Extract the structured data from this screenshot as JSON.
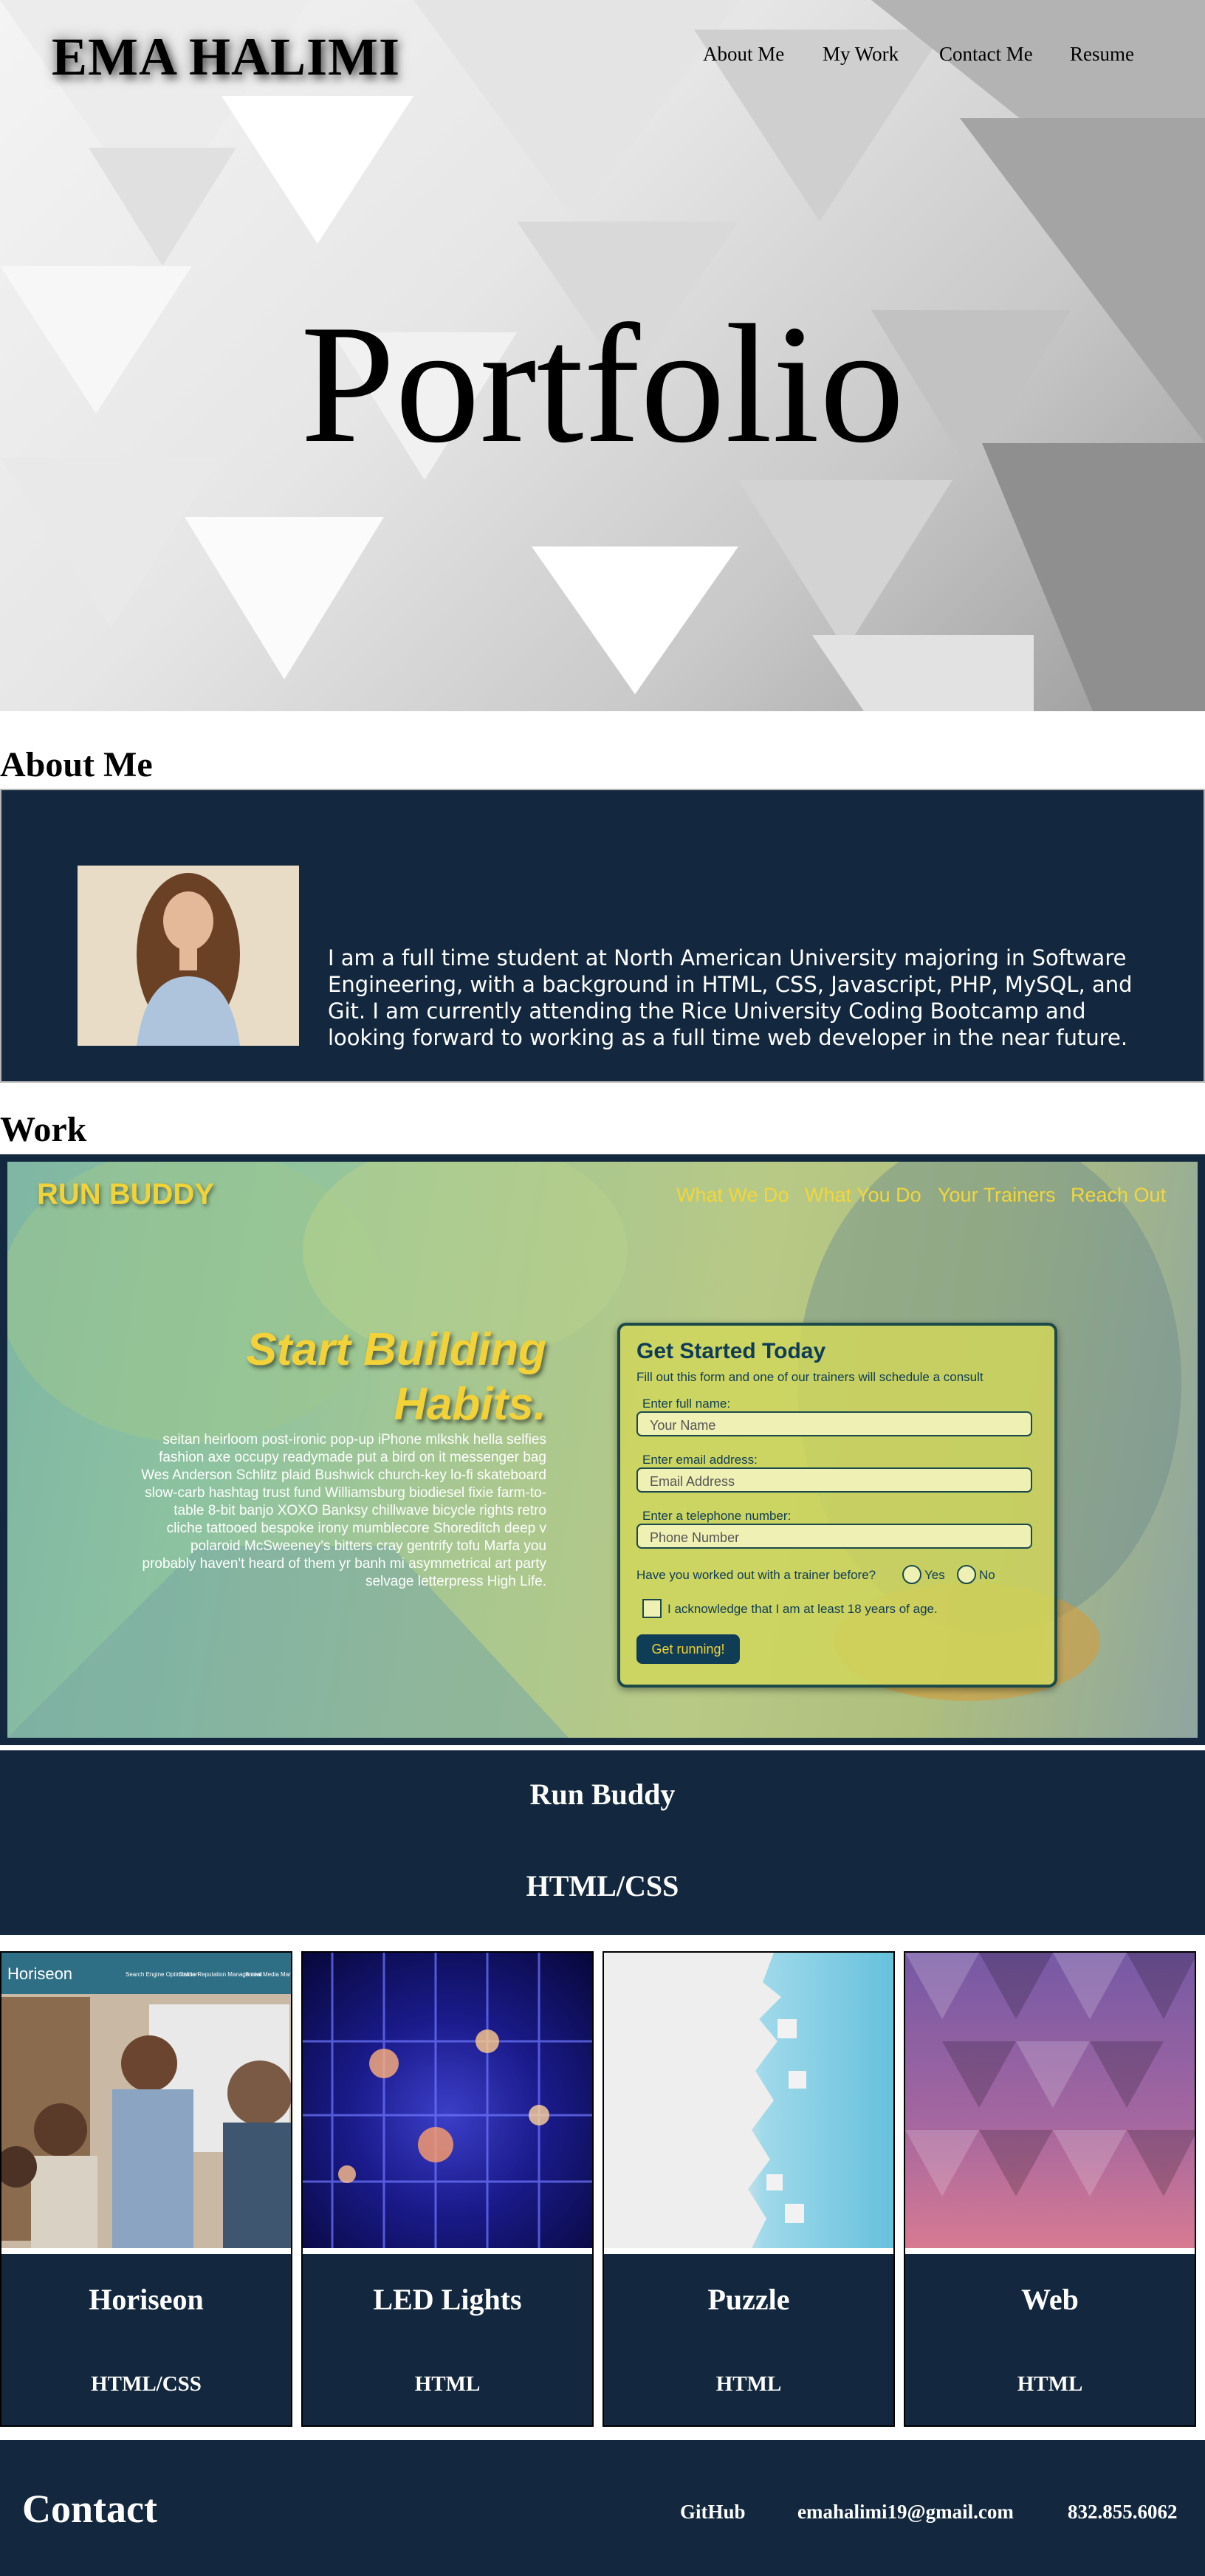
{
  "header": {
    "logo": "EMA HALIMI",
    "nav": [
      "About Me",
      "My Work",
      "Contact Me",
      "Resume"
    ]
  },
  "hero": {
    "title": "Portfolio"
  },
  "about": {
    "heading": "About Me",
    "bio": "I am a full time student at North American University majoring in Software Engineering, with a background in HTML, CSS, Javascript, PHP, MySQL, and Git. I am currently attending the Rice University Coding Bootcamp and looking forward to working as a full time web developer in the near future."
  },
  "work": {
    "heading": "Work",
    "featured": {
      "title": "Run Buddy",
      "subtitle": "HTML/CSS",
      "preview": {
        "logo": "RUN BUDDY",
        "nav": [
          "What We Do",
          "What You Do",
          "Your Trainers",
          "Reach Out"
        ],
        "headline_1": "Start Building",
        "headline_2": "Habits.",
        "paragraph": "seitan heirloom post-ironic pop-up iPhone mlkshk hella selfies fashion axe occupy readymade put a bird on it messenger bag Wes Anderson Schlitz plaid Bushwick church-key lo-fi skateboard slow-carb hashtag trust fund Williamsburg biodiesel fixie farm-to-table 8-bit banjo XOXO Banksy chillwave bicycle rights retro cliche tattooed bespoke irony mumblecore Shoreditch deep v polaroid McSweeney's bitters cray gentrify tofu Marfa you probably haven't heard of them yr banh mi asymmetrical art party selvage letterpress High Life.",
        "form": {
          "title": "Get Started Today",
          "subtitle": "Fill out this form and one of our trainers will schedule a consult",
          "name_label": "Enter full name:",
          "name_placeholder": "Your Name",
          "email_label": "Enter email address:",
          "email_placeholder": "Email Address",
          "phone_label": "Enter a telephone number:",
          "phone_placeholder": "Phone Number",
          "trainer_question": "Have you worked out with a trainer before?",
          "yes": "Yes",
          "no": "No",
          "ack": "I acknowledge that I am at least 18 years of age.",
          "button": "Get running!"
        }
      }
    },
    "projects": [
      {
        "title": "Horiseon",
        "subtitle": "HTML/CSS",
        "thumb_title": "Horiseon",
        "thumb_nav": [
          "Search Engine Optimization",
          "Online Reputation Management",
          "Social Media Marketing"
        ]
      },
      {
        "title": "LED Lights",
        "subtitle": "HTML"
      },
      {
        "title": "Puzzle",
        "subtitle": "HTML"
      },
      {
        "title": "Web",
        "subtitle": "HTML"
      }
    ]
  },
  "contact": {
    "heading": "Contact",
    "github": "GitHub",
    "email": "emahalimi19@gmail.com",
    "phone": "832.855.6062"
  },
  "colors": {
    "navy": "#13283e",
    "runbuddy_yellow": "#f2d238"
  }
}
